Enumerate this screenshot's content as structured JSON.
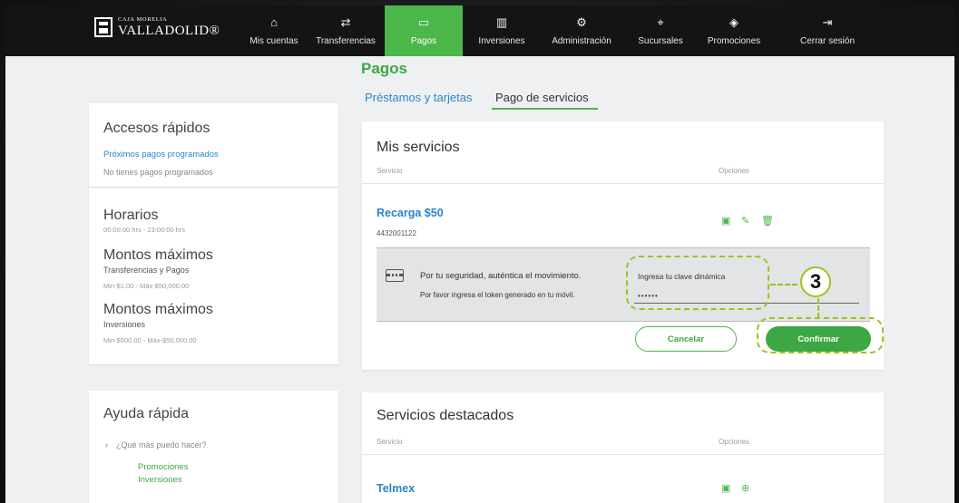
{
  "brand": {
    "line1": "CAJA MORELIA",
    "line2": "VALLADOLID®"
  },
  "nav": [
    {
      "label": "Mis cuentas",
      "icon": "home-icon",
      "glyph": "⌂"
    },
    {
      "label": "Transferencias",
      "icon": "transfer-icon",
      "glyph": "⇄"
    },
    {
      "label": "Pagos",
      "icon": "payment-icon",
      "glyph": "▭"
    },
    {
      "label": "Inversiones",
      "icon": "chart-icon",
      "glyph": "▥"
    },
    {
      "label": "Administración",
      "icon": "gear-icon",
      "glyph": "⚙"
    },
    {
      "label": "Sucursales",
      "icon": "location-icon",
      "glyph": "⌖"
    },
    {
      "label": "Promociones",
      "icon": "tag-icon",
      "glyph": "◈"
    },
    {
      "label": "Cerrar sesión",
      "icon": "logout-icon",
      "glyph": "⇥"
    }
  ],
  "page": {
    "title": "Pagos",
    "tabs": [
      "Préstamos y tarjetas",
      "Pago de servicios"
    ],
    "active_tab": "Pago de servicios"
  },
  "quick_access": {
    "title": "Accesos rápidos",
    "scheduled_link": "Próximos pagos programados",
    "scheduled_empty": "No tienes pagos programados",
    "hours_title": "Horarios",
    "hours_value": "06:00:00 hrs - 23:00:00 hrs",
    "max1_title": "Montos máximos",
    "max1_sub": "Transferencias y Pagos",
    "max1_range": "Min-$1.00 - Máx-$50,000.00",
    "max2_title": "Montos máximos",
    "max2_sub": "Inversiones",
    "max2_range": "Min-$500.00 - Máx-$50,000.00"
  },
  "quick_help": {
    "title": "Ayuda rápida",
    "question": "¿Qué más puedo hacer?",
    "links": [
      "Promociones",
      "Inversiones"
    ]
  },
  "my_services": {
    "title": "Mis servicios",
    "col_service": "Servicio",
    "col_options": "Opciones",
    "service_name": "Recarga $50",
    "service_number": "4432001122"
  },
  "auth": {
    "line1": "Por tu seguridad, auténtica el movimiento.",
    "line2": "Por favor ingresa el token generado en tu móvil.",
    "field_label": "Ingresa tu clave dinámica",
    "field_value": "••••••"
  },
  "buttons": {
    "cancel": "Cancelar",
    "confirm": "Confirmar"
  },
  "annotation": {
    "step": "3",
    "color": "#9cc31f"
  },
  "featured": {
    "title": "Servicios destacados",
    "col_service": "Servicio",
    "col_options": "Opciones",
    "item": "Telmex"
  },
  "colors": {
    "accent": "#4cb74a",
    "link": "#2a86c6",
    "nav_bg": "#141414"
  }
}
